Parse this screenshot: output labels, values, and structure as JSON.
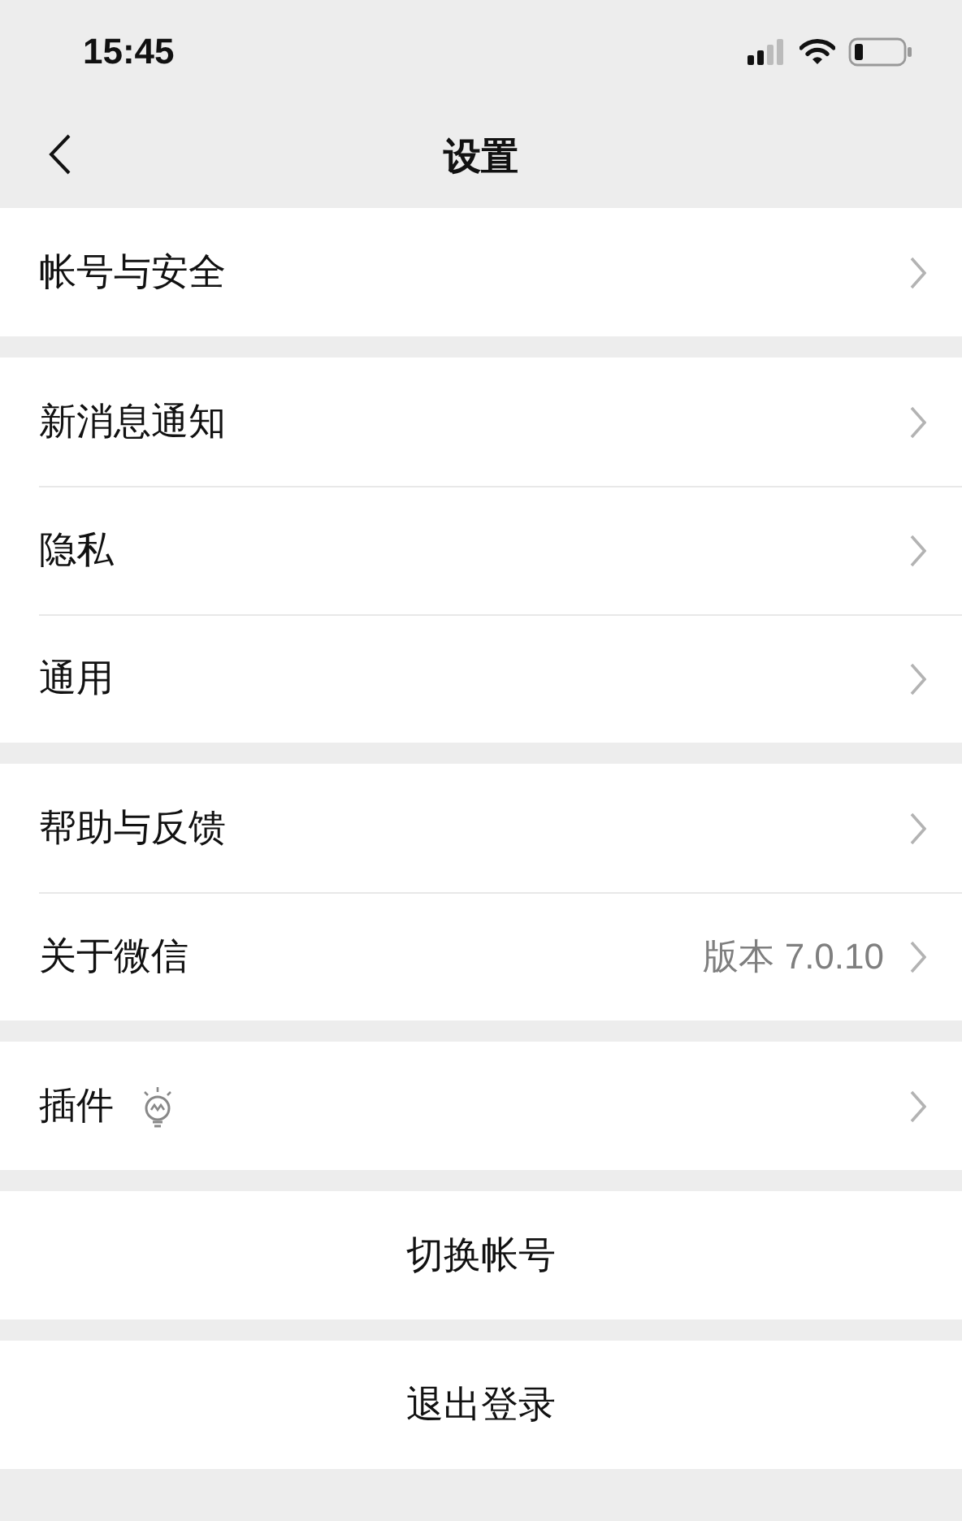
{
  "status_bar": {
    "time": "15:45"
  },
  "nav_bar": {
    "title": "设置"
  },
  "groups": [
    {
      "items": [
        {
          "kind": "link",
          "label": "帐号与安全"
        }
      ]
    },
    {
      "items": [
        {
          "kind": "link",
          "label": "新消息通知"
        },
        {
          "kind": "link",
          "label": "隐私"
        },
        {
          "kind": "link",
          "label": "通用"
        }
      ]
    },
    {
      "items": [
        {
          "kind": "link",
          "label": "帮助与反馈"
        },
        {
          "kind": "link",
          "label": "关于微信",
          "value": "版本 7.0.10"
        }
      ]
    },
    {
      "items": [
        {
          "kind": "link_icon",
          "label": "插件"
        }
      ]
    }
  ],
  "buttons": [
    "切换帐号",
    "退出登录"
  ]
}
